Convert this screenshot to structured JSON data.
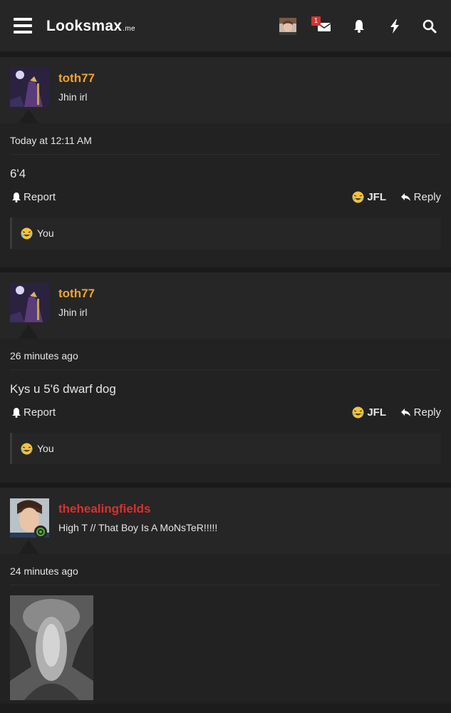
{
  "header": {
    "logo_main": "Looksmax",
    "logo_tld": ".me",
    "inbox_badge": "1",
    "icons": [
      "menu-icon",
      "envelope-icon",
      "bell-icon",
      "bolt-icon",
      "search-icon"
    ]
  },
  "posts": [
    {
      "username": "toth77",
      "user_title": "Jhin irl",
      "date": "Today at 12:11 AM",
      "body": "6'4",
      "report_label": "Report",
      "reaction_label": "JFL",
      "reply_label": "Reply",
      "reaction_by": "You"
    },
    {
      "username": "toth77",
      "user_title": "Jhin irl",
      "date": "26 minutes ago",
      "body": "Kys u 5'6 dwarf dog",
      "report_label": "Report",
      "reaction_label": "JFL",
      "reply_label": "Reply",
      "reaction_by": "You"
    },
    {
      "username": "thehealingfields",
      "user_title": "High T // That Boy Is A MoNsTeR!!!!!",
      "date": "24 minutes ago"
    }
  ],
  "colors": {
    "username_orange": "#f0a430",
    "username_red": "#d9312f",
    "online_green": "#55b33a",
    "background": "#1c1c1c"
  }
}
